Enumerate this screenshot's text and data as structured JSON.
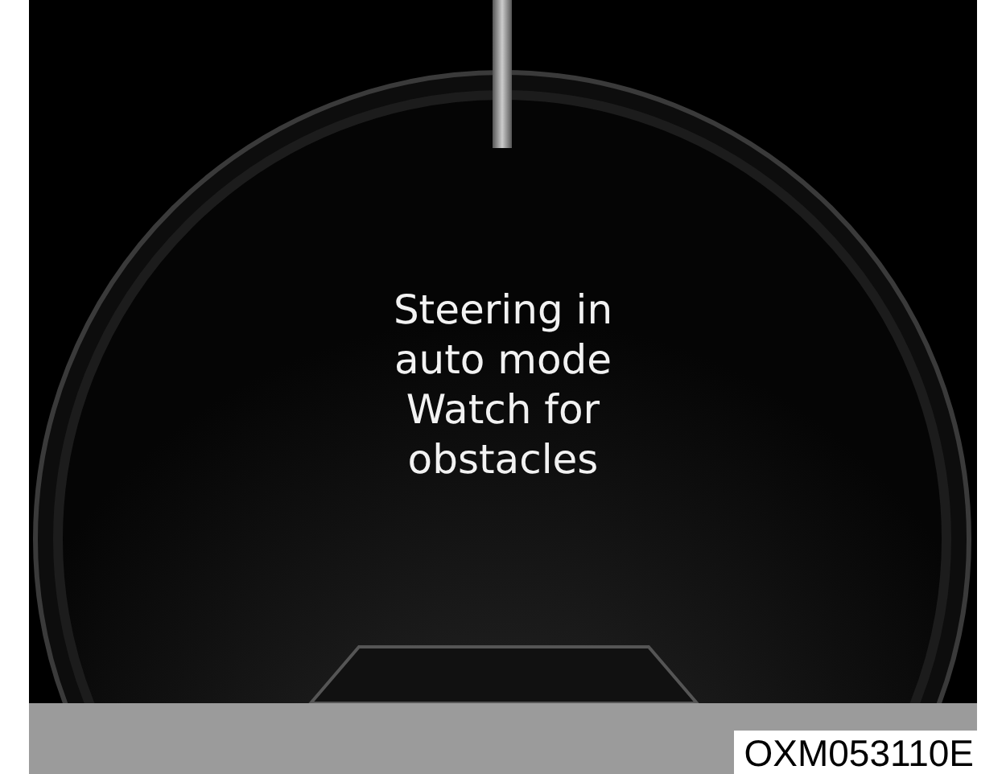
{
  "display": {
    "message": [
      "Steering in",
      "auto mode",
      "Watch for",
      "obstacles"
    ]
  },
  "figure_code": "OXM053110E"
}
